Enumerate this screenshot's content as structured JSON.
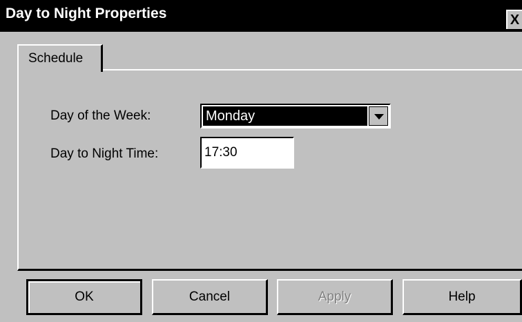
{
  "window": {
    "title": "Day to Night Properties",
    "close_glyph": "X"
  },
  "tabs": [
    {
      "label": "Schedule",
      "selected": true
    }
  ],
  "form": {
    "day_label": "Day of the Week:",
    "day_value": "Monday",
    "time_label": "Day to Night Time:",
    "time_value": "17:30"
  },
  "buttons": {
    "ok": "OK",
    "cancel": "Cancel",
    "apply": "Apply",
    "help": "Help"
  },
  "colors": {
    "face": "#c0c0c0",
    "titlebar": "#000000",
    "selection": "#000000",
    "disabled_text": "#808080"
  }
}
